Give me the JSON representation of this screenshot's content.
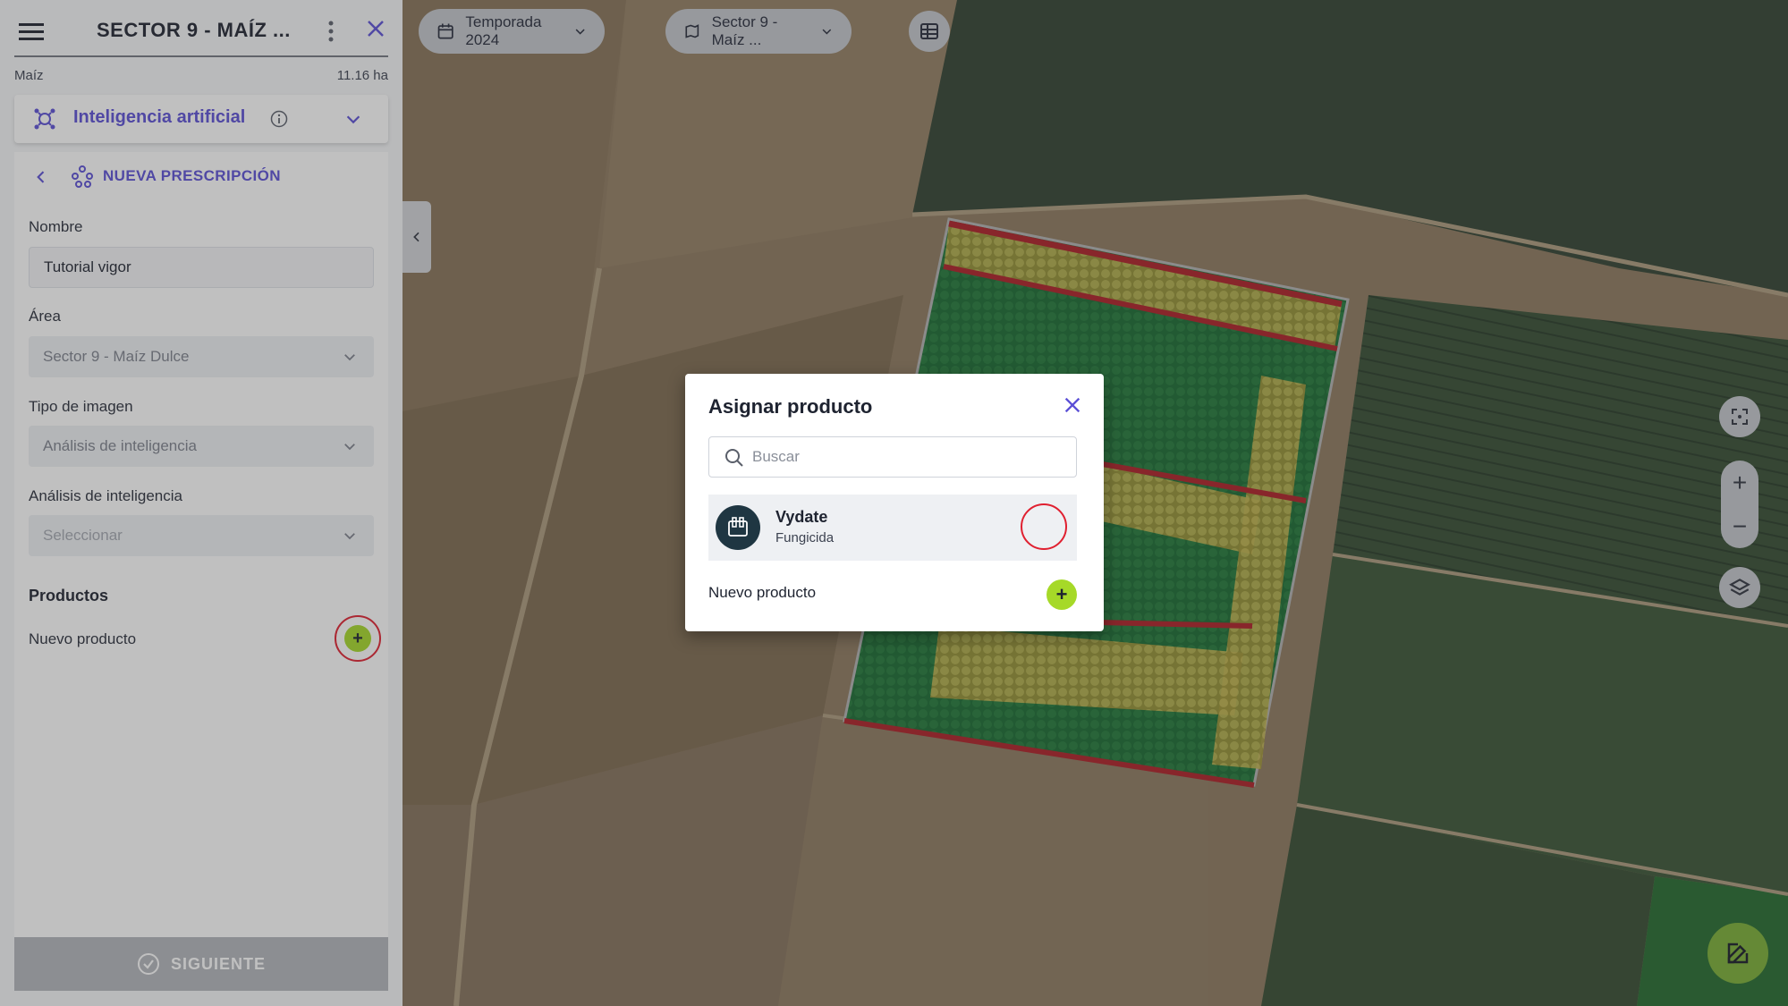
{
  "sidebar": {
    "title": "SECTOR 9 - MAÍZ ...",
    "crop": "Maíz",
    "area_size": "11.16 ha",
    "module": "Inteligencia artificial",
    "prescription": "NUEVA PRESCRIPCIÓN",
    "form": {
      "name_label": "Nombre",
      "name_value": "Tutorial vigor",
      "area_label": "Área",
      "area_value": "Sector 9 - Maíz Dulce",
      "image_type_label": "Tipo de imagen",
      "image_type_value": "Análisis de inteligencia",
      "analysis_label": "Análisis de inteligencia",
      "analysis_placeholder": "Seleccionar",
      "products_title": "Productos",
      "new_product": "Nuevo producto"
    },
    "next_button": "SIGUIENTE"
  },
  "topbar": {
    "season": "Temporada 2024",
    "sector": "Sector 9 - Maíz ..."
  },
  "modal": {
    "title": "Asignar producto",
    "search_placeholder": "Buscar",
    "items": [
      {
        "name": "Vydate",
        "type": "Fungicida"
      }
    ],
    "new_product": "Nuevo producto"
  },
  "colors": {
    "accent": "#5b4fd6",
    "add_button": "#a6d928",
    "highlight_ring": "#e02030",
    "fab": "#8cc63f"
  },
  "icons": [
    "menu-icon",
    "more-vert-icon",
    "close-icon",
    "ai-network-icon",
    "info-icon",
    "chevron-down-icon",
    "chevron-left-icon",
    "prescription-icon",
    "check-circle-icon",
    "calendar-icon",
    "field-map-icon",
    "table-icon",
    "recenter-icon",
    "zoom-in-icon",
    "zoom-out-icon",
    "layers-icon",
    "edit-icon",
    "search-icon",
    "product-icon",
    "plus-icon"
  ]
}
